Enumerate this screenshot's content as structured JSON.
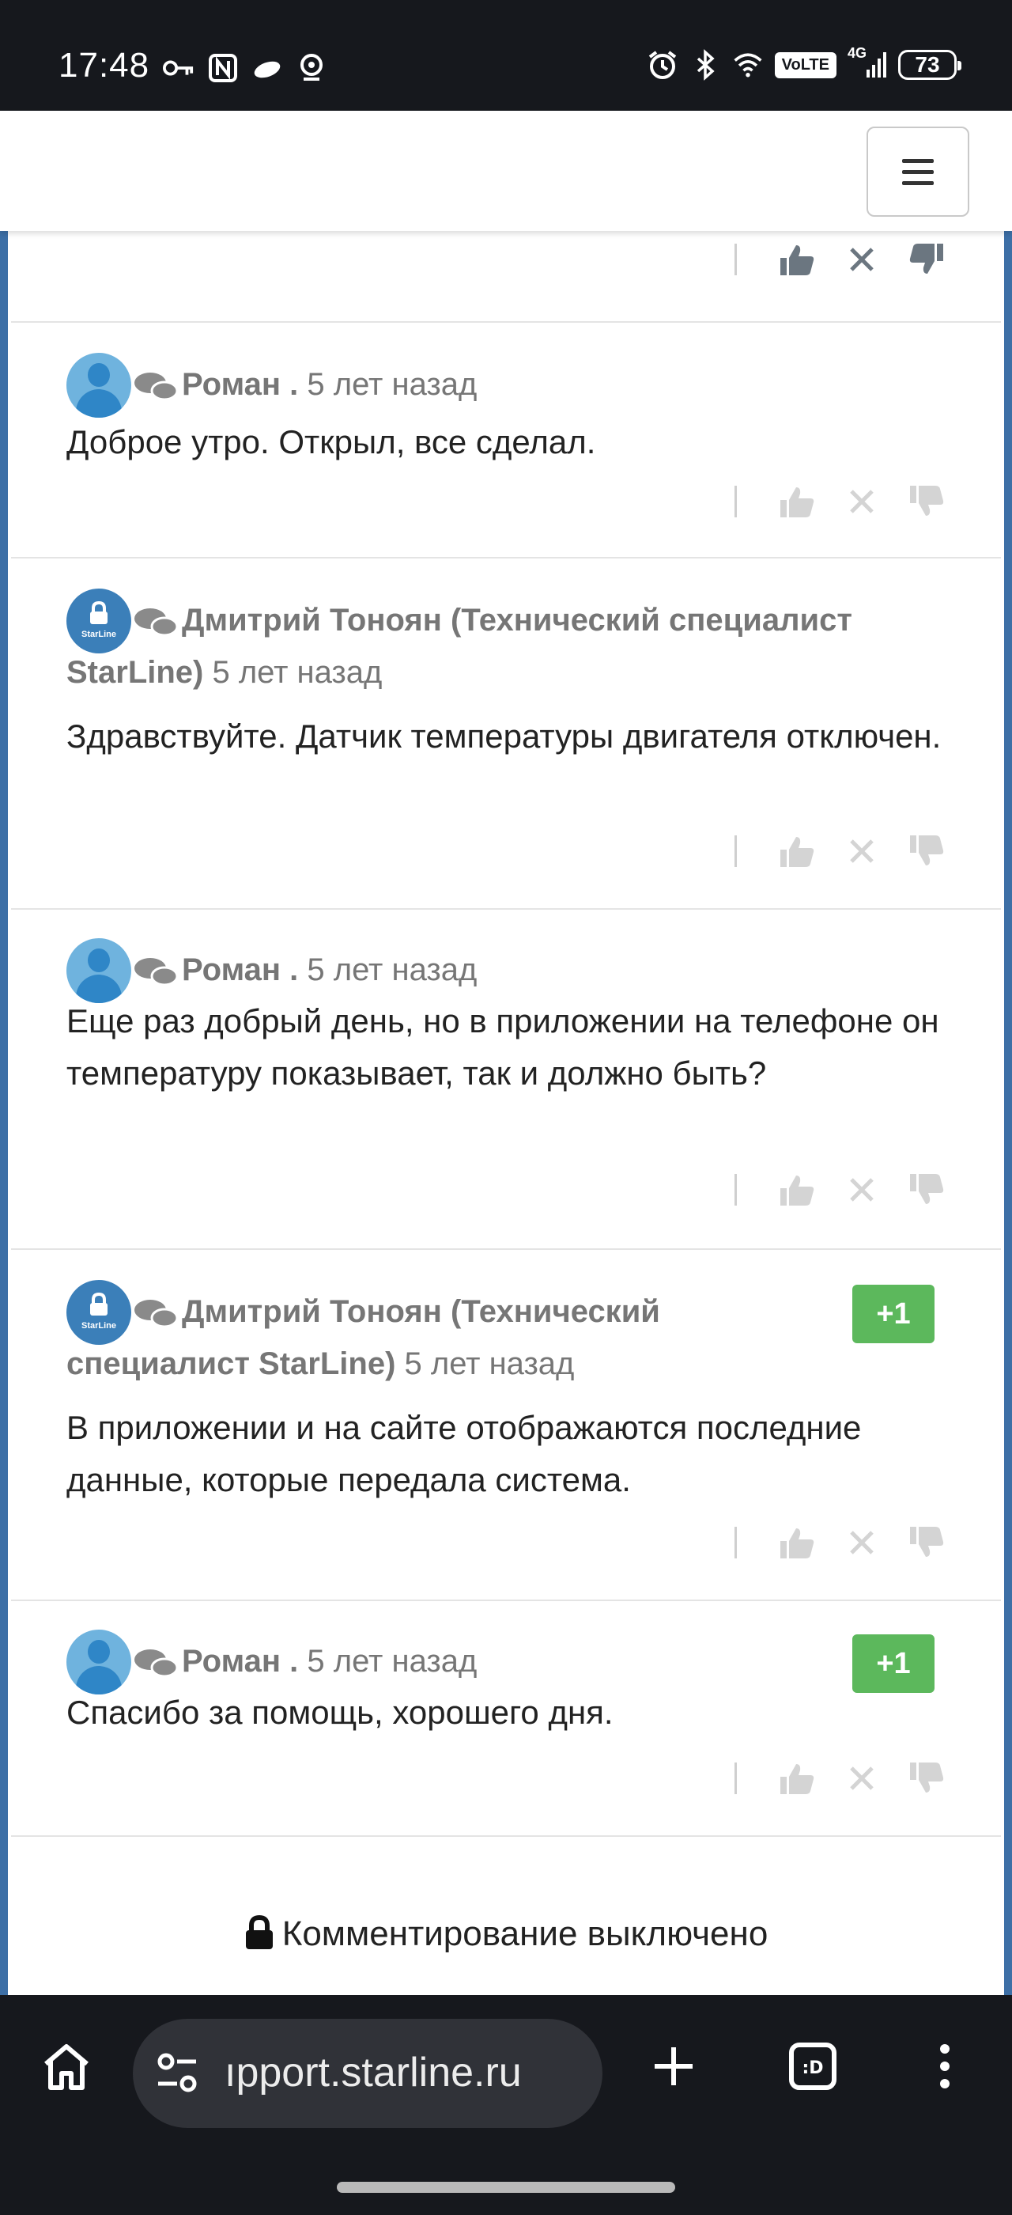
{
  "status_bar": {
    "time": "17:48",
    "network": "4G",
    "volte": "VoLTE",
    "battery": "73"
  },
  "header": {
    "menu_icon": "hamburger-icon"
  },
  "comments": [
    {
      "author": "Роман .",
      "time": "5 лет назад",
      "text": "Доброе утро. Открыл, все сделал."
    },
    {
      "author": "Дмитрий Тоноян (Технический специалист",
      "author_cont": "StarLine)",
      "time": "5 лет назад",
      "text": "Здравствуйте. Датчик температуры двигателя отключен."
    },
    {
      "author": "Роман .",
      "time": "5 лет назад",
      "text": "Еще раз добрый день, но в приложении на телефоне он температуру показывает, так и должно быть?"
    },
    {
      "author": "Дмитрий Тоноян (Технический",
      "author_cont": "специалист StarLine)",
      "time": "5 лет назад",
      "text": "В приложении и на сайте отображаются последние данные, которые передала система.",
      "badge": "+1"
    },
    {
      "author": "Роман .",
      "time": "5 лет назад",
      "text": "Спасибо за помощь, хорошего дня.",
      "badge": "+1"
    }
  ],
  "avatar_label": "StarLine",
  "commenting_disabled": "Комментирование выключено",
  "browser": {
    "url": "ıpport.starline.ru"
  },
  "colors": {
    "rail": "#3d6fa6",
    "badge": "#5cb85c",
    "status_bar": "#16181d"
  }
}
